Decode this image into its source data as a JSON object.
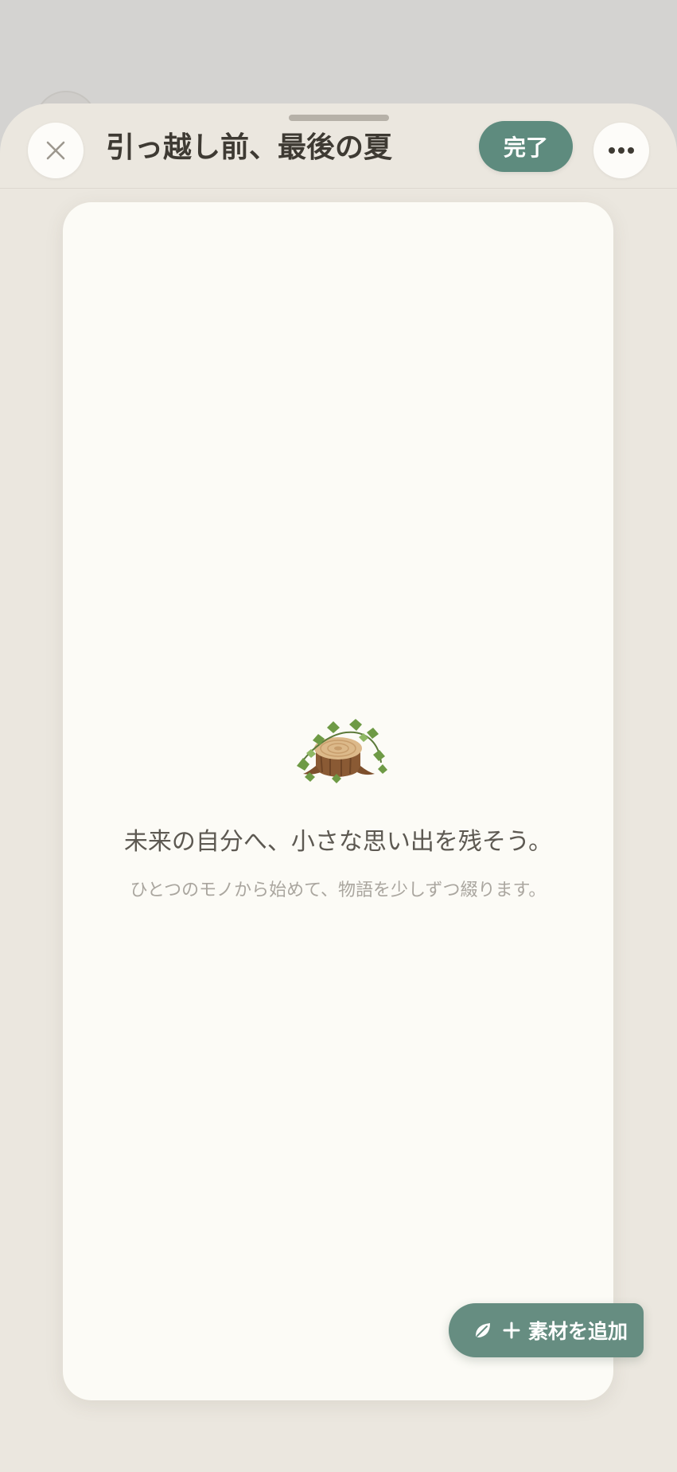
{
  "sheet": {
    "title": "引っ越し前、最後の夏",
    "done_label": "完了",
    "close_icon": "close-icon",
    "more_icon": "more-horizontal-icon"
  },
  "canvas": {
    "empty_state": {
      "illustration": "tree-stump-ivy-icon",
      "title": "未来の自分へ、小さな思い出を残そう。",
      "subtitle": "ひとつのモノから始めて、物語を少しずつ綴ります。"
    }
  },
  "fab": {
    "label": "素材を追加",
    "icons": [
      "leaf-icon",
      "plus-icon"
    ]
  },
  "colors": {
    "accent": "#5e8b7e",
    "sheet_background": "#ebe7df",
    "canvas_background": "#fcfbf6",
    "title_text": "#3e3a33",
    "muted_text": "#aaa69f"
  }
}
